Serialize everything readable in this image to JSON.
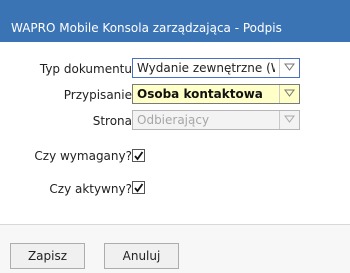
{
  "window": {
    "title": "WAPRO Mobile Konsola zarządzająca - Podpis"
  },
  "form": {
    "document_type": {
      "label": "Typ dokumentu",
      "value": "Wydanie zewnętrzne (W"
    },
    "assignment": {
      "label": "Przypisanie",
      "value": "Osoba kontaktowa"
    },
    "side": {
      "label": "Strona",
      "value": "Odbierający"
    },
    "required": {
      "label": "Czy wymagany?",
      "checked": true
    },
    "active": {
      "label": "Czy aktywny?",
      "checked": true
    }
  },
  "buttons": {
    "save": "Zapisz",
    "cancel": "Anuluj"
  },
  "colors": {
    "titlebar": "#3b74b5",
    "highlight": "#ffffc8",
    "active_border": "#4a6fc4"
  },
  "icons": {
    "dropdown": "chevron-down-icon",
    "check": "checkmark-icon"
  }
}
